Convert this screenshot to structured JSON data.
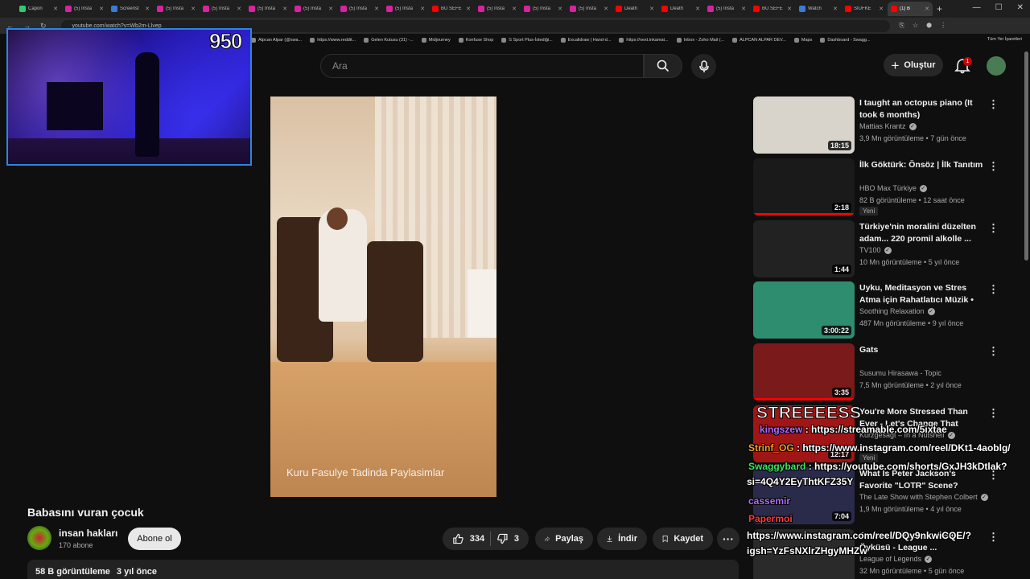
{
  "tabs": [
    {
      "title": "Capon",
      "color": "#2ecc71",
      "active": false
    },
    {
      "title": "(5) Insta",
      "color": "#d6249f",
      "active": false
    },
    {
      "title": "Screenst",
      "color": "#3a7bd5",
      "active": false
    },
    {
      "title": "(5) Insta",
      "color": "#d6249f",
      "active": false
    },
    {
      "title": "(5) Insta",
      "color": "#d6249f",
      "active": false
    },
    {
      "title": "(5) Insta",
      "color": "#d6249f",
      "active": false
    },
    {
      "title": "(5) Insta",
      "color": "#d6249f",
      "active": false
    },
    {
      "title": "(5) Insta",
      "color": "#d6249f",
      "active": false
    },
    {
      "title": "(5) Insta",
      "color": "#d6249f",
      "active": false
    },
    {
      "title": "BU SEFE",
      "color": "#ff0000",
      "active": false
    },
    {
      "title": "(5) Insta",
      "color": "#d6249f",
      "active": false
    },
    {
      "title": "(5) Insta",
      "color": "#d6249f",
      "active": false
    },
    {
      "title": "(5) Insta",
      "color": "#d6249f",
      "active": false
    },
    {
      "title": "Death",
      "color": "#ff0000",
      "active": false
    },
    {
      "title": "Death",
      "color": "#ff0000",
      "active": false
    },
    {
      "title": "(5) Insta",
      "color": "#d6249f",
      "active": false
    },
    {
      "title": "BU SEFE",
      "color": "#ff0000",
      "active": false
    },
    {
      "title": "Watch",
      "color": "#3a7bd5",
      "active": false
    },
    {
      "title": "SIUFKE",
      "color": "#ff0000",
      "active": false
    },
    {
      "title": "(1) B",
      "color": "#ff0000",
      "active": true
    }
  ],
  "address": {
    "url": "youtube.com/watch?v=Wb2m-Llvep"
  },
  "bookmarks": [
    "Alpcan Alpar (@swa...",
    "https://www.reddit...",
    "Gelen Kutusu (31) -...",
    "Midjourney",
    "Konfuse Shop",
    "S Sport Plus-İstediği...",
    "Excalidraw | Hand-d...",
    "https://next.inkamat...",
    "Inbox - Zoho Mail (...",
    "ALPCAN ALPAR DEV...",
    "Maps",
    "Dashboard - Swagg..."
  ],
  "bookmarks_all": "Tüm Yer İşaretleri",
  "search": {
    "placeholder": "Ara"
  },
  "header": {
    "create_label": "Oluştur",
    "notif_count": "1"
  },
  "overlay": {
    "counter": "950",
    "stream_label": "STREEEESS"
  },
  "video": {
    "caption": "Kuru Fasulye Tadinda Paylasimlar",
    "title": "Babasını vuran çocuk",
    "channel": "insan hakları",
    "subscribers": "170 abone",
    "subscribe_label": "Abone ol",
    "likes": "334",
    "dislikes": "3",
    "share_label": "Paylaş",
    "download_label": "İndir",
    "save_label": "Kaydet",
    "views": "58 B görüntüleme",
    "age": "3 yıl önce"
  },
  "recommendations": [
    {
      "title": "I taught an octopus piano (It took 6 months)",
      "channel": "Mattias Krantz",
      "verified": true,
      "meta": "3,9 Mn görüntüleme • 7 gün önce",
      "duration": "18:15",
      "new_label": "",
      "thumb_color": "#d8d4cc",
      "progress": 0
    },
    {
      "title": "İlk Göktürk: Önsöz | İlk Tanıtım",
      "channel": "HBO Max Türkiye",
      "verified": true,
      "meta": "82 B görüntüleme • 12 saat önce",
      "duration": "2:18",
      "new_label": "Yeni",
      "thumb_color": "#1a1a1a",
      "progress": 1.0
    },
    {
      "title": "Türkiye'nin moralini düzelten adam... 220 promil alkolle ...",
      "channel": "TV100",
      "verified": true,
      "meta": "10 Mn görüntüleme • 5 yıl önce",
      "duration": "1:44",
      "new_label": "",
      "thumb_color": "#222222",
      "progress": 0
    },
    {
      "title": "Uyku, Meditasyon ve Stres Atma için Rahatlatıcı Müzik • Flying",
      "channel": "Soothing Relaxation",
      "verified": true,
      "meta": "487 Mn görüntüleme • 9 yıl önce",
      "duration": "3:00:22",
      "new_label": "",
      "thumb_color": "#2f8d6f",
      "progress": 0
    },
    {
      "title": "Gats",
      "channel": "Susumu Hirasawa - Topic",
      "verified": false,
      "meta": "7,5 Mn görüntüleme • 2 yıl önce",
      "duration": "3:35",
      "new_label": "",
      "thumb_color": "#7a1a1a",
      "progress": 1.0
    },
    {
      "title": "You're More Stressed Than Ever - Let's Change That",
      "channel": "Kurzgesagt – In a Nutshell",
      "verified": true,
      "meta": "",
      "duration": "12:17",
      "new_label": "Yeni",
      "thumb_color": "#a01515",
      "progress": 0
    },
    {
      "title": "What Is Peter Jackson's Favorite \"LOTR\" Scene? Steph...",
      "channel": "The Late Show with Stephen Colbert",
      "verified": true,
      "meta": "1,9 Mn görüntüleme • 4 yıl önce",
      "duration": "7:04",
      "new_label": "",
      "thumb_color": "#2a2a4a",
      "progress": 0
    },
    {
      "title": "Arcane Animasyon Video Öyküsü - League ...",
      "channel": "League of Legends",
      "verified": true,
      "meta": "32 Mn görüntüleme • 5 gün önce",
      "duration": "",
      "new_label": "",
      "thumb_color": "#2a2a2a",
      "progress": 0
    }
  ],
  "chat": [
    {
      "user": "kingszew",
      "user_color": "#b36bff",
      "msg": "https://streamable.com/5ixtae"
    },
    {
      "user": "Strinf_OG",
      "user_color": "#ff9f1c",
      "msg": "https://www.instagram.com/reel/DKt1-4aoblg/"
    },
    {
      "user": "Swaggybard",
      "user_color": "#39e75f",
      "msg": "https://youtube.com/shorts/GxJH3kDtlak?"
    },
    {
      "user": "",
      "user_color": "#ffffff",
      "msg": "si=4Q4Y2EyThtKFZ35Y"
    },
    {
      "user": "cassemir",
      "user_color": "#b36bff",
      "msg": ""
    },
    {
      "user": "Papermoi",
      "user_color": "#ff3b3b",
      "msg": ""
    },
    {
      "user": "",
      "user_color": "#ffffff",
      "msg": "https://www.instagram.com/reel/DQy9nkwiCQE/?"
    },
    {
      "user": "",
      "user_color": "#ffffff",
      "msg": "igsh=YzFsNXlrZHgyMHZw"
    }
  ]
}
